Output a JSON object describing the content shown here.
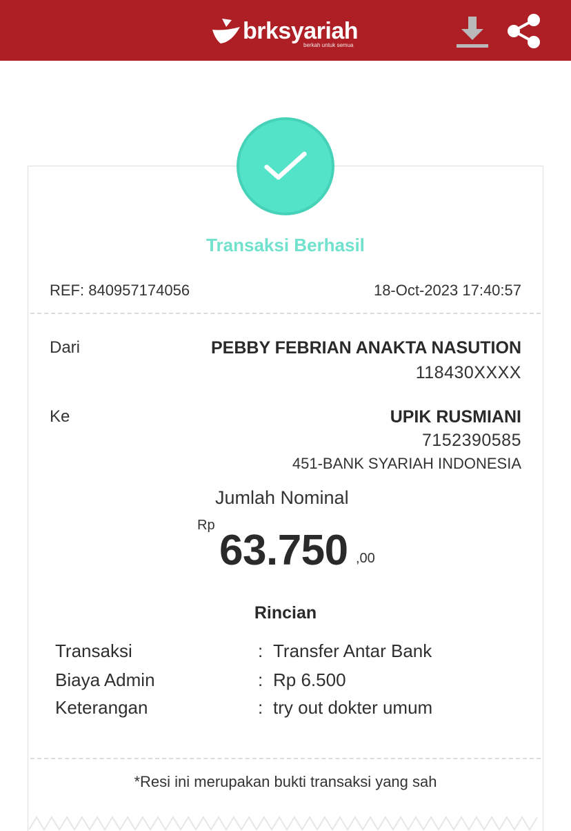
{
  "header": {
    "logo_text": "brksyariah",
    "logo_tagline": "berkah untuk semua",
    "brand_color": "#ad1f24",
    "download_icon": "download-icon",
    "share_icon": "share-icon"
  },
  "receipt": {
    "status": "Transaksi Berhasil",
    "status_color": "#52e3c8",
    "ref": "REF: 840957174056",
    "datetime": "18-Oct-2023 17:40:57",
    "from": {
      "label": "Dari",
      "name": "PEBBY FEBRIAN ANAKTA NASUTION",
      "account": "118430XXXX"
    },
    "to": {
      "label": "Ke",
      "name": "UPIK RUSMIANI",
      "account": "7152390585",
      "bank": "451-BANK SYARIAH INDONESIA"
    },
    "amount": {
      "label": "Jumlah Nominal",
      "currency": "Rp",
      "value": "63.750",
      "cents": ",00"
    },
    "details": {
      "title": "Rincian",
      "rows": [
        {
          "label": "Transaksi",
          "sep": ":",
          "value": "Transfer Antar Bank"
        },
        {
          "label": "Biaya Admin",
          "sep": ":",
          "value": "Rp 6.500"
        },
        {
          "label": "Keterangan",
          "sep": ":",
          "value": "try out dokter umum"
        }
      ]
    },
    "footnote": "*Resi ini merupakan bukti transaksi yang sah"
  }
}
